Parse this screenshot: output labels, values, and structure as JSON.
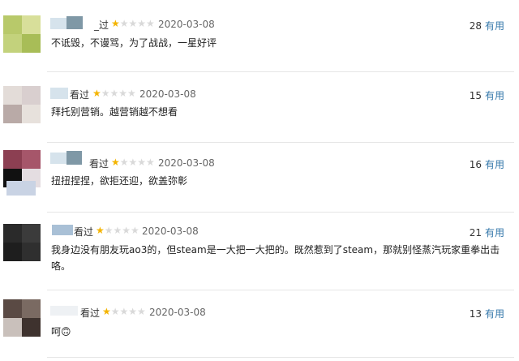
{
  "reviews": [
    {
      "status": "过",
      "rating": 1,
      "max": 5,
      "date": "2020-03-08",
      "votes": "28",
      "useful": "有用",
      "text": "不诋毁，不谩骂，为了战战，一星好评"
    },
    {
      "status": "看过",
      "rating": 1,
      "max": 5,
      "date": "2020-03-08",
      "votes": "15",
      "useful": "有用",
      "text": "拜托别营销。越营销越不想看"
    },
    {
      "status": "看过",
      "rating": 1,
      "max": 5,
      "date": "2020-03-08",
      "votes": "16",
      "useful": "有用",
      "text": "扭扭捏捏，欲拒还迎，欲盖弥彰"
    },
    {
      "status": "看过",
      "rating": 1,
      "max": 5,
      "date": "2020-03-08",
      "votes": "21",
      "useful": "有用",
      "text": "我身边没有朋友玩ao3的，但steam是一大把一大把的。既然惹到了steam，那就别怪蒸汽玩家重拳出击咯。"
    },
    {
      "status": "看过",
      "rating": 1,
      "max": 5,
      "date": "2020-03-08",
      "votes": "13",
      "useful": "有用",
      "text": "呵🙃"
    }
  ],
  "colors": {
    "star": "#f4b400",
    "link": "#3377aa"
  }
}
